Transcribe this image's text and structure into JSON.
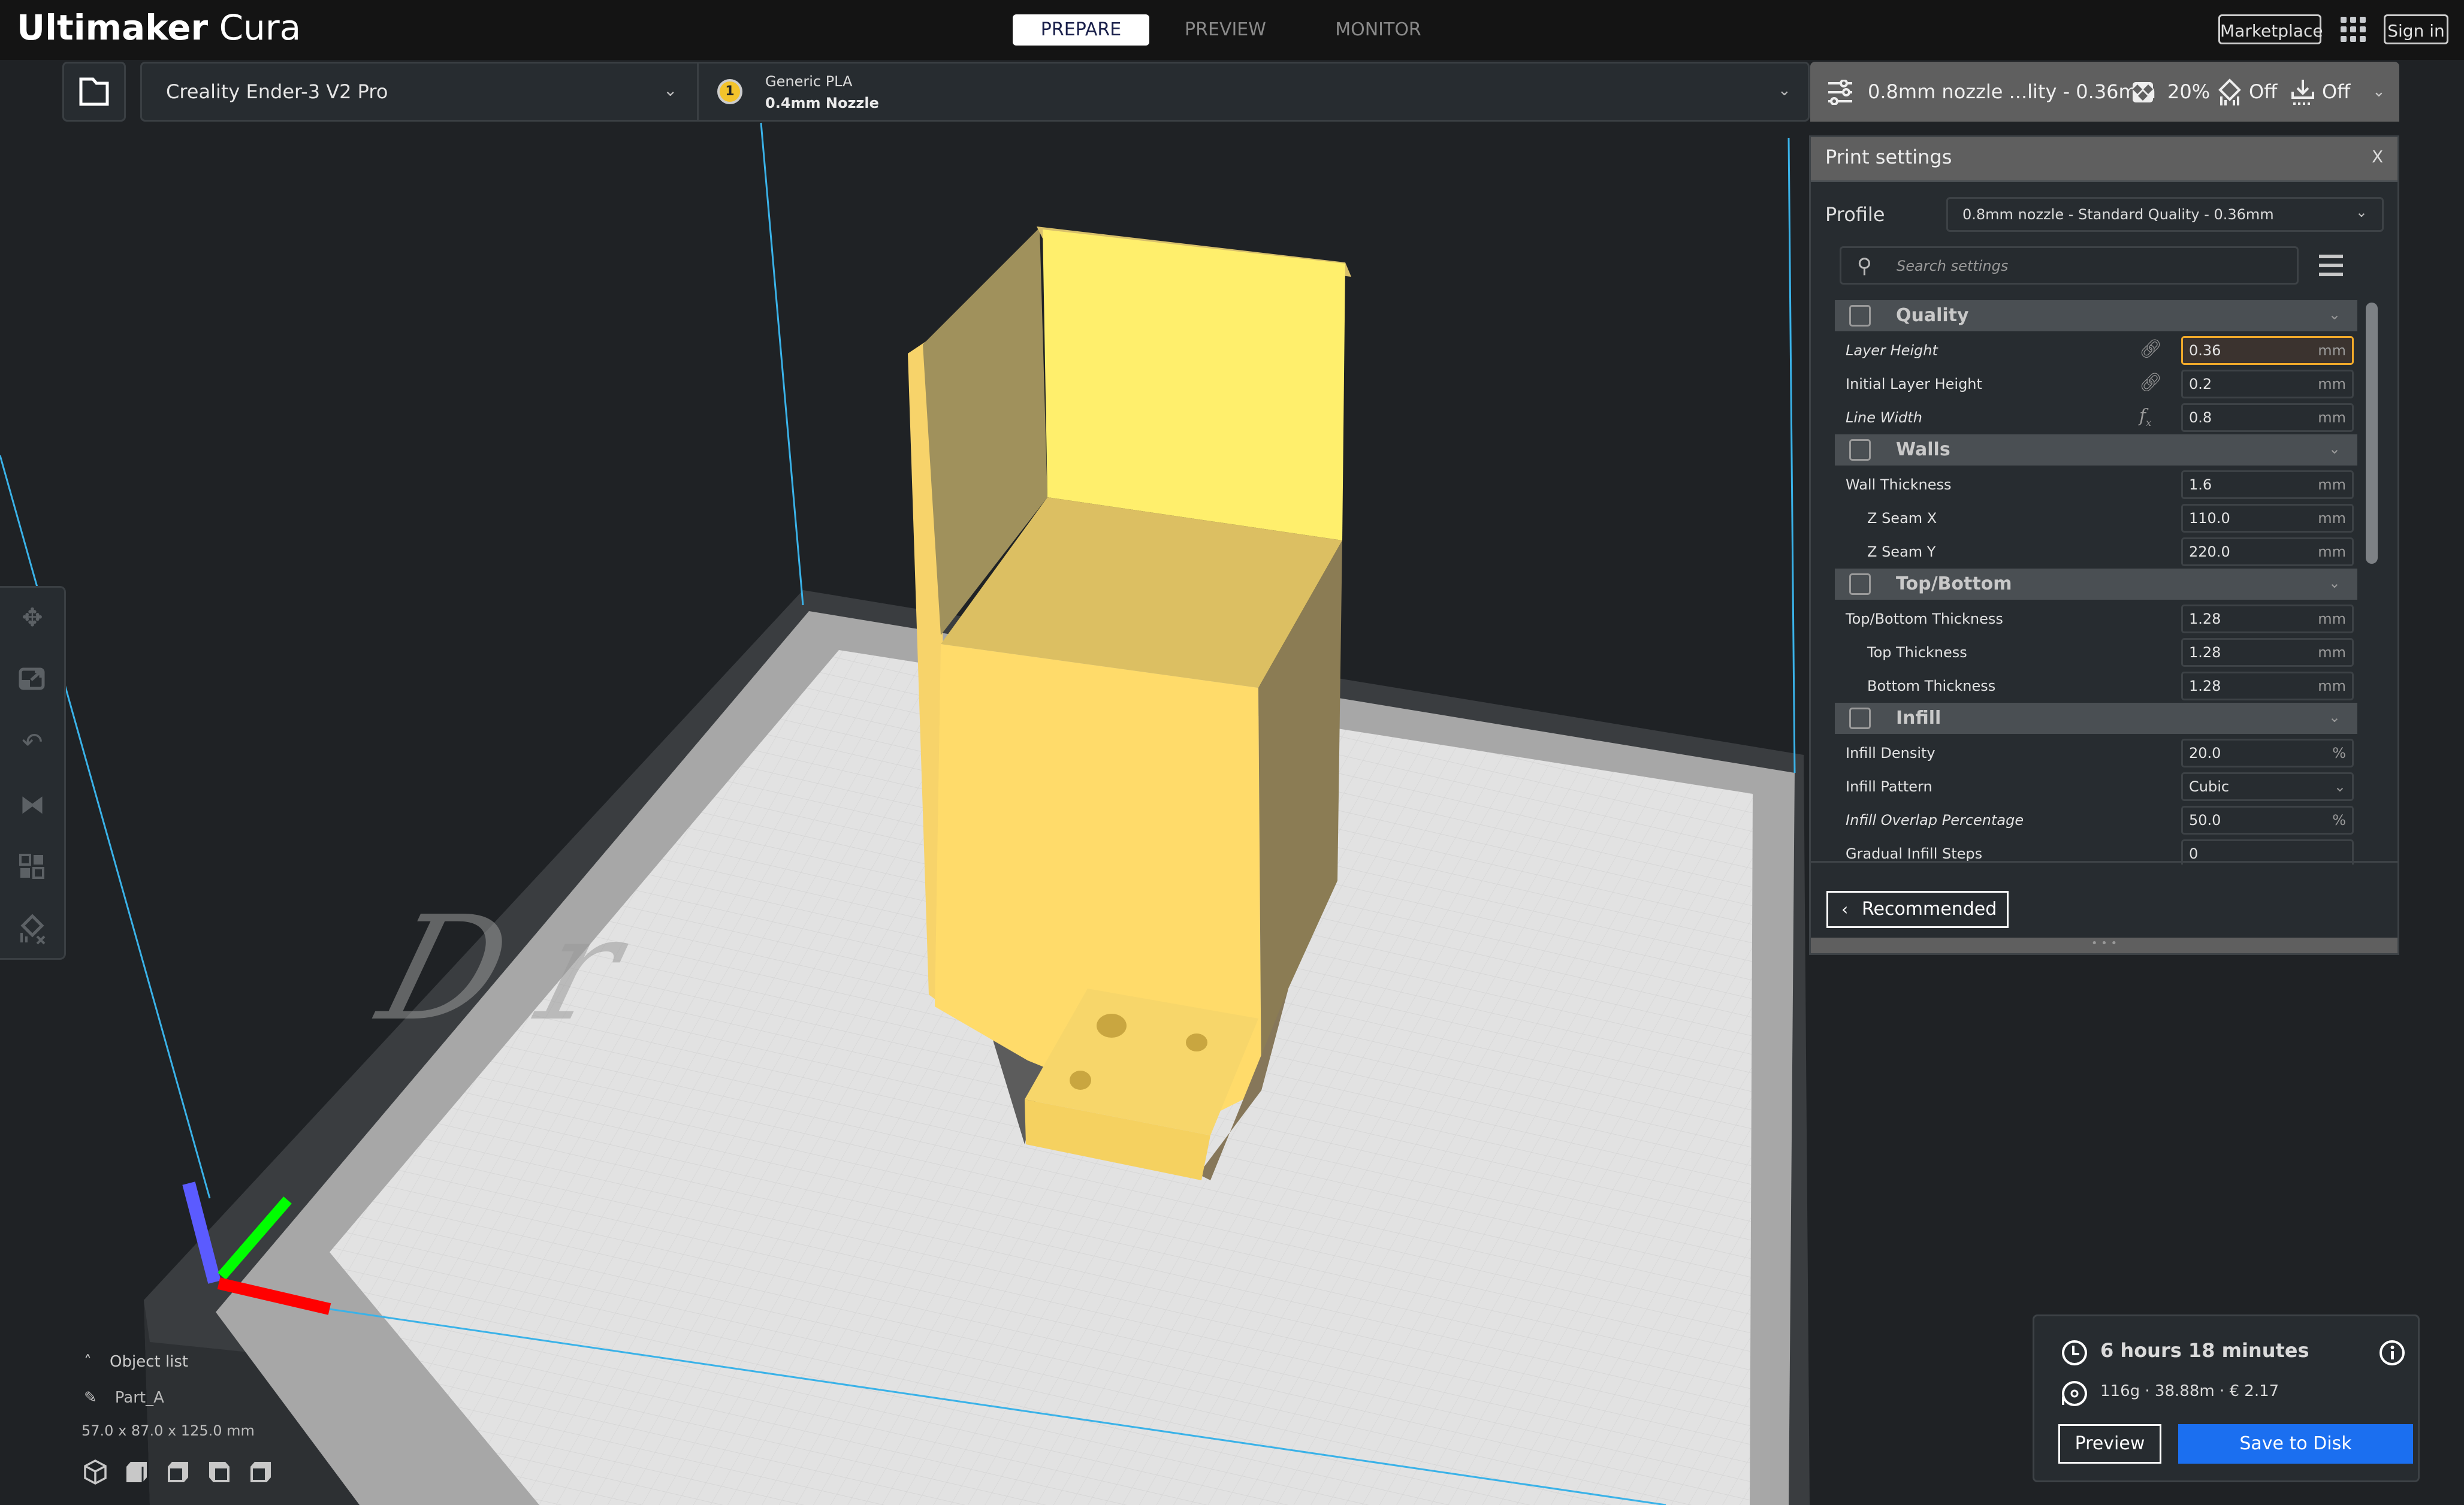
{
  "app": {
    "title_bold": "Ultimaker",
    "title_light": "Cura"
  },
  "header": {
    "stages": [
      {
        "label": "PREPARE",
        "active": true
      },
      {
        "label": "PREVIEW",
        "active": false
      },
      {
        "label": "MONITOR",
        "active": false
      }
    ],
    "marketplace_label": "Marketplace",
    "signin_label": "Sign in",
    "apps_icon": "grid-icon"
  },
  "machine_bar": {
    "open_icon": "folder-icon",
    "printer": "Creality Ender-3 V2 Pro",
    "extruder_number": "1",
    "material": "Generic PLA",
    "nozzle": "0.4mm Nozzle",
    "material_color": "#f3c32b"
  },
  "settings_summary": {
    "profile_short": "0.8mm nozzle ...lity - 0.36mm",
    "infill": "20%",
    "support": "Off",
    "adhesion": "Off"
  },
  "print_settings": {
    "title": "Print settings",
    "close_label": "X",
    "profile_label": "Profile",
    "profile_value": "0.8mm nozzle - Standard Quality - 0.36mm",
    "search_placeholder": "Search settings",
    "categories": [
      {
        "label": "Quality",
        "icon": "quality-icon",
        "settings": [
          {
            "label": "Layer Height",
            "value": "0.36",
            "unit": "mm",
            "italic": true,
            "active": true,
            "icon": "link-icon"
          },
          {
            "label": "Initial Layer Height",
            "value": "0.2",
            "unit": "mm",
            "italic": false,
            "icon": "link-icon"
          },
          {
            "label": "Line Width",
            "value": "0.8",
            "unit": "mm",
            "italic": true,
            "icon": "function-icon"
          }
        ]
      },
      {
        "label": "Walls",
        "icon": "walls-icon",
        "settings": [
          {
            "label": "Wall Thickness",
            "value": "1.6",
            "unit": "mm"
          },
          {
            "label": "Z Seam X",
            "value": "110.0",
            "unit": "mm",
            "sub": true
          },
          {
            "label": "Z Seam Y",
            "value": "220.0",
            "unit": "mm",
            "sub": true
          }
        ]
      },
      {
        "label": "Top/Bottom",
        "icon": "top-bottom-icon",
        "settings": [
          {
            "label": "Top/Bottom Thickness",
            "value": "1.28",
            "unit": "mm"
          },
          {
            "label": "Top Thickness",
            "value": "1.28",
            "unit": "mm",
            "sub": true
          },
          {
            "label": "Bottom Thickness",
            "value": "1.28",
            "unit": "mm",
            "sub": true
          }
        ]
      },
      {
        "label": "Infill",
        "icon": "infill-icon",
        "settings": [
          {
            "label": "Infill Density",
            "value": "20.0",
            "unit": "%"
          },
          {
            "label": "Infill Pattern",
            "value": "Cubic",
            "unit": "⌄",
            "dropdown": true
          },
          {
            "label": "Infill Overlap Percentage",
            "value": "50.0",
            "unit": "%",
            "italic": true
          },
          {
            "label": "Gradual Infill Steps",
            "value": "0",
            "unit": ""
          }
        ]
      }
    ],
    "recommended_label": "Recommended"
  },
  "object_list": {
    "toggle_label": "Object list",
    "object_name": "Part_A",
    "dimensions": "57.0 x 87.0 x 125.0 mm",
    "view_buttons": [
      "3d-view",
      "front-view",
      "top-view",
      "left-view",
      "right-view"
    ]
  },
  "tools": [
    "move-icon",
    "scale-icon",
    "rotate-icon",
    "mirror-icon",
    "per-model-settings-icon",
    "support-blocker-icon"
  ],
  "action_panel": {
    "print_time": "6 hours 18 minutes",
    "stats": "116g · 38.88m · € 2.17",
    "preview_label": "Preview",
    "save_label": "Save to Disk"
  },
  "colors": {
    "model": "#ffe066",
    "accent_blue": "#1b6ff0",
    "active_field": "#f0a92a"
  }
}
